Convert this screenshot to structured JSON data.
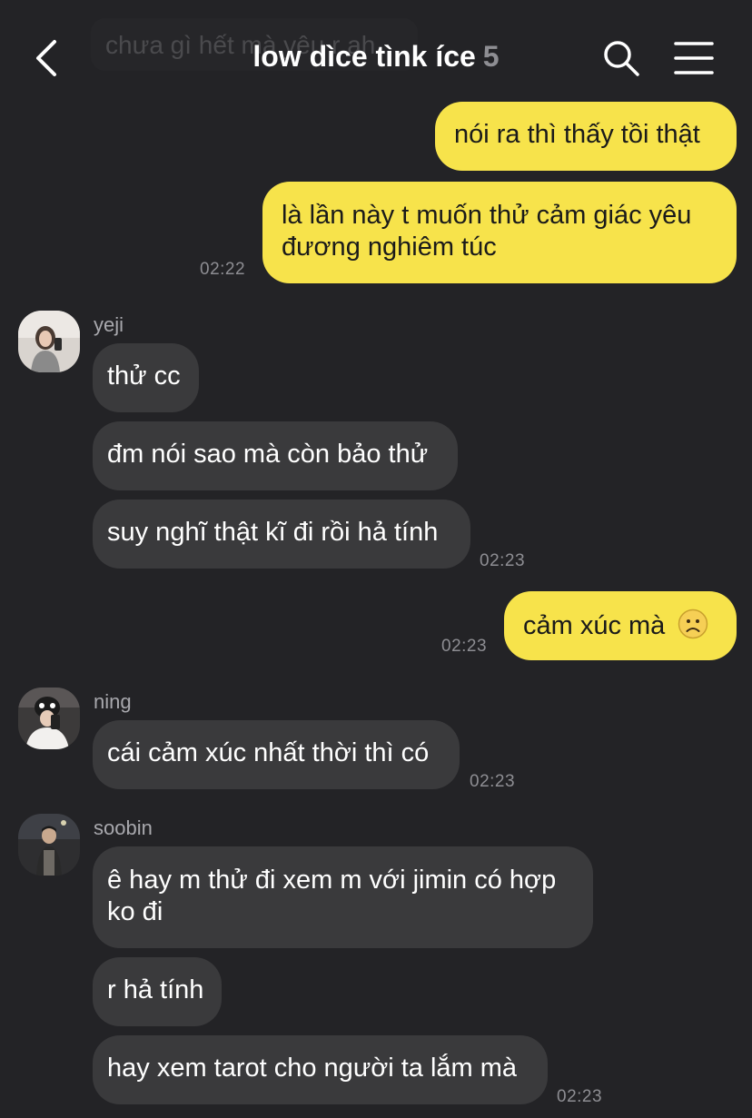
{
  "header": {
    "title": "low dìce tìnk íce",
    "member_count": "5",
    "ghost_preview": "chưa gì hết mà yêu r ah"
  },
  "messages": [
    {
      "text": "nói ra thì thấy tồi thật"
    },
    {
      "text_line1": "là lần này t muốn thử cảm giác yêu",
      "text_line2": "đương nghiêm túc",
      "time": "02:22"
    },
    {
      "sender": "yeji",
      "text": "thử cc"
    },
    {
      "text": "đm nói sao mà còn bảo thử"
    },
    {
      "text": "suy nghĩ thật kĩ đi rồi hả tính",
      "time": "02:23"
    },
    {
      "text": "cảm xúc mà",
      "emoji": "frowning-face",
      "time": "02:23"
    },
    {
      "sender": "ning",
      "text": "cái cảm xúc nhất thời thì có",
      "time": "02:23"
    },
    {
      "sender": "soobin",
      "text_line1": "ê hay m thử đi xem m với jimin có hợp",
      "text_line2": "ko đi"
    },
    {
      "text": "r hả tính"
    },
    {
      "text": "hay xem tarot cho người ta lắm mà",
      "time": "02:23"
    }
  ],
  "colors": {
    "background": "#232326",
    "my_bubble": "#f7e34b",
    "their_bubble": "#3a3a3c",
    "timestamp": "#8e8e93"
  }
}
